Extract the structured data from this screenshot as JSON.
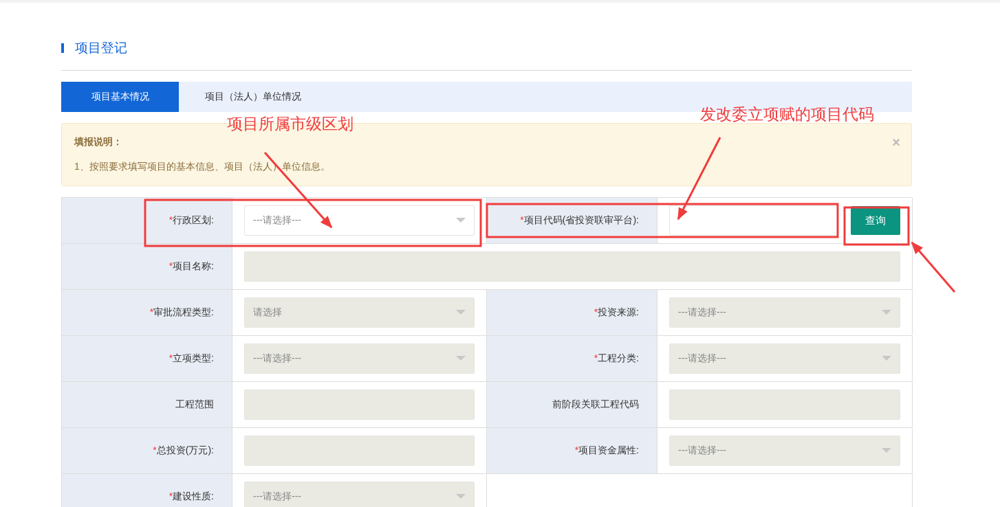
{
  "heading": "项目登记",
  "tabs": [
    {
      "label": "项目基本情况",
      "selected": true
    },
    {
      "label": "项目（法人）单位情况",
      "selected": false
    }
  ],
  "notice": {
    "title": "填报说明：",
    "text": "1、按照要求填写项目的基本信息、项目（法人）单位信息。",
    "close": "×"
  },
  "form_rows": [
    {
      "cells": [
        {
          "mark": "*",
          "label": "行政区划:",
          "field": {
            "kind": "select",
            "disabled": false,
            "placeholder": "---请选择---"
          }
        },
        {
          "mark": "*",
          "label": "项目代码(省投资联审平台):",
          "field": {
            "kind": "text",
            "disabled": false,
            "button": "查询"
          }
        }
      ]
    },
    {
      "cells": [
        {
          "mark": "*",
          "label": "项目名称:",
          "field": {
            "kind": "text",
            "disabled": true
          }
        }
      ]
    },
    {
      "cells": [
        {
          "mark": "*",
          "label": "审批流程类型:",
          "field": {
            "kind": "select",
            "disabled": true,
            "placeholder": "请选择"
          }
        },
        {
          "mark": "*",
          "label": "投资来源:",
          "field": {
            "kind": "select",
            "disabled": true,
            "placeholder": "---请选择---"
          }
        }
      ]
    },
    {
      "cells": [
        {
          "mark": "*",
          "label": "立项类型:",
          "field": {
            "kind": "select",
            "disabled": true,
            "placeholder": "---请选择---"
          }
        },
        {
          "mark": "*",
          "label": "工程分类:",
          "field": {
            "kind": "select",
            "disabled": true,
            "placeholder": "---请选择---"
          }
        }
      ]
    },
    {
      "cells": [
        {
          "label": "工程范围",
          "field": {
            "kind": "text",
            "disabled": true
          }
        },
        {
          "label": "前阶段关联工程代码",
          "field": {
            "kind": "text",
            "disabled": true
          }
        }
      ]
    },
    {
      "cells": [
        {
          "mark": "*",
          "label": "总投资(万元):",
          "field": {
            "kind": "text",
            "disabled": true
          }
        },
        {
          "mark": "*",
          "label": "项目资金属性:",
          "field": {
            "kind": "select",
            "disabled": true,
            "placeholder": "---请选择---"
          }
        }
      ]
    },
    {
      "cells": [
        {
          "mark": "*",
          "label": "建设性质:",
          "field": {
            "kind": "select",
            "disabled": true,
            "placeholder": "---请选择---"
          }
        }
      ]
    }
  ],
  "annotations": [
    {
      "text": "项目所属市级区划"
    },
    {
      "text": "发改委立项赋的项目代码"
    }
  ]
}
